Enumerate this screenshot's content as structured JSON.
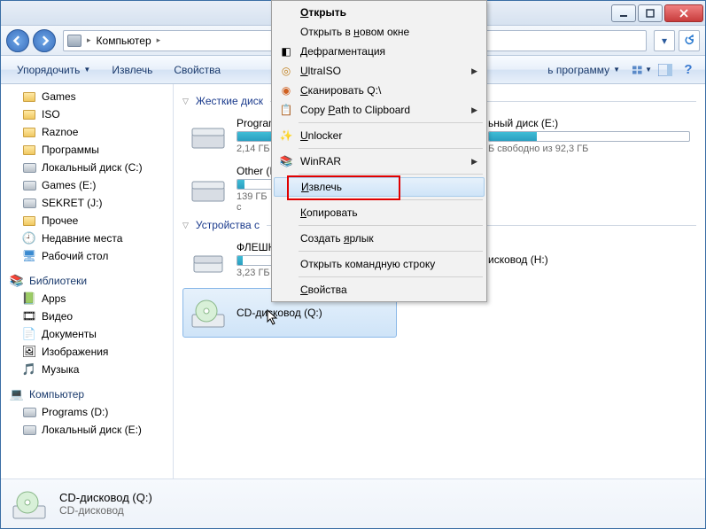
{
  "breadcrumb": {
    "location": "Компьютер"
  },
  "toolbar": {
    "organize": "Упорядочить",
    "eject": "Извлечь",
    "properties": "Свойства",
    "program": "ь программу"
  },
  "sidebar": {
    "favorites": [
      {
        "label": "Games"
      },
      {
        "label": "ISO"
      },
      {
        "label": "Raznoe"
      },
      {
        "label": "Программы"
      },
      {
        "label": "Локальный диск (C:)"
      },
      {
        "label": "Games (E:)"
      },
      {
        "label": "SEKRET (J:)"
      },
      {
        "label": "Прочее"
      },
      {
        "label": "Недавние места"
      },
      {
        "label": "Рабочий стол"
      }
    ],
    "libraries_header": "Библиотеки",
    "libraries": [
      {
        "label": "Apps"
      },
      {
        "label": "Видео"
      },
      {
        "label": "Документы"
      },
      {
        "label": "Изображения"
      },
      {
        "label": "Музыка"
      }
    ],
    "computer_header": "Компьютер",
    "computer": [
      {
        "label": "Programs (D:)"
      },
      {
        "label": "Локальный диск (E:)"
      }
    ]
  },
  "main": {
    "group_hdd": "Жесткие диск",
    "group_removable": "Устройства с",
    "drives": {
      "d0": {
        "name": "Program",
        "free": "2,14 ГБ"
      },
      "d1": {
        "name": "ьный диск (E:)",
        "free": "Б свободно из 92,3 ГБ"
      },
      "d2": {
        "name": "Other (I",
        "free": "139 ГБ с"
      },
      "r0": {
        "name": "ФЛЕШК",
        "free": "3,23 ГБ"
      },
      "r1": {
        "name": "исковод (H:)"
      },
      "cd": {
        "name": "CD-дисковод (Q:)"
      }
    }
  },
  "details": {
    "title": "CD-дисковод (Q:)",
    "subtitle": "CD-дисковод"
  },
  "context_menu": {
    "open": "Открыть",
    "open_new": "Открыть в новом окне",
    "defrag": "Дефрагментация",
    "ultraiso": "UltraISO",
    "scan": "Сканировать Q:\\",
    "copypath": "Copy Path to Clipboard",
    "unlocker": "Unlocker",
    "winrar": "WinRAR",
    "eject": "Извлечь",
    "copy": "Копировать",
    "shortcut": "Создать ярлык",
    "cmd": "Открыть командную строку",
    "properties": "Свойства",
    "u": {
      "open": "О",
      "new": "н",
      "ultraiso": "U",
      "scan": "С",
      "copypath": "P",
      "unlocker": "U",
      "eject": "И",
      "copy_ch": "К",
      "shortcut": "я",
      "props": "С"
    }
  }
}
